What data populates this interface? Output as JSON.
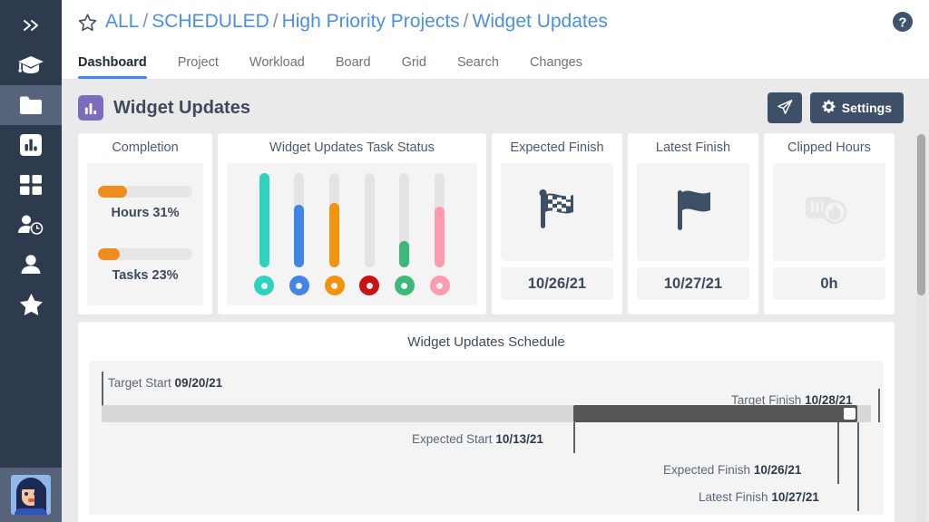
{
  "sidebar": {
    "items": [
      {
        "name": "collapse-expand",
        "icon": "chevron-double-right-icon",
        "active": false
      },
      {
        "name": "learning",
        "icon": "graduation-cap-icon",
        "active": false
      },
      {
        "name": "projects",
        "icon": "folder-icon",
        "active": true
      },
      {
        "name": "reports",
        "icon": "bar-chart-icon",
        "active": false
      },
      {
        "name": "boards",
        "icon": "grid-icon",
        "active": false
      },
      {
        "name": "timesheets",
        "icon": "user-clock-icon",
        "active": false
      },
      {
        "name": "people",
        "icon": "user-icon",
        "active": false
      },
      {
        "name": "favorites",
        "icon": "star-icon",
        "active": false
      }
    ],
    "avatar_label": "user-avatar"
  },
  "header": {
    "favorite_icon": "star-outline-icon",
    "help_icon": "help-circle-icon",
    "breadcrumb": [
      {
        "label": "ALL"
      },
      {
        "label": "SCHEDULED"
      },
      {
        "label": "High Priority Projects"
      },
      {
        "label": "Widget Updates"
      }
    ],
    "separator": "/",
    "tabs": [
      {
        "label": "Dashboard",
        "active": true
      },
      {
        "label": "Project",
        "active": false
      },
      {
        "label": "Workload",
        "active": false
      },
      {
        "label": "Board",
        "active": false
      },
      {
        "label": "Grid",
        "active": false
      },
      {
        "label": "Search",
        "active": false
      },
      {
        "label": "Changes",
        "active": false
      }
    ],
    "active_tab_color": "#3d8bf2",
    "link_color": "#4a90e2"
  },
  "page": {
    "title": "Widget Updates",
    "title_icon": "bar-chart-icon",
    "title_badge_color": "#7c6bbf",
    "send_button": {
      "label": "",
      "icon": "paper-plane-icon"
    },
    "settings_button": {
      "label": "Settings",
      "icon": "gear-icon"
    }
  },
  "cards": {
    "completion": {
      "title": "Completion",
      "bars": [
        {
          "label": "Hours 31%",
          "percent": 31,
          "color": "#f08c1c"
        },
        {
          "label": "Tasks 23%",
          "percent": 23,
          "color": "#f08c1c"
        }
      ]
    },
    "task_status": {
      "title": "Widget Updates Task Status",
      "gauges": [
        {
          "name": "status-1",
          "percent": 100,
          "color": "#2ed3c0"
        },
        {
          "name": "status-2",
          "percent": 66,
          "color": "#4285e8"
        },
        {
          "name": "status-3",
          "percent": 68,
          "color": "#f2930d"
        },
        {
          "name": "status-4",
          "percent": 0,
          "color": "#cc1111"
        },
        {
          "name": "status-5",
          "percent": 28,
          "color": "#3cb878"
        },
        {
          "name": "status-6",
          "percent": 64,
          "color": "#ff9bb0"
        }
      ]
    },
    "expected_finish": {
      "title": "Expected Finish",
      "icon": "checkered-flag-icon",
      "value": "10/26/21"
    },
    "latest_finish": {
      "title": "Latest Finish",
      "icon": "flag-icon",
      "value": "10/27/21"
    },
    "clipped_hours": {
      "title": "Clipped Hours",
      "icon": "clipped-hours-icon",
      "value": "0h"
    }
  },
  "schedule": {
    "title": "Widget Updates Schedule",
    "markers": [
      {
        "name": "target-start",
        "label": "Target Start",
        "value": "09/20/21"
      },
      {
        "name": "target-finish",
        "label": "Target Finish",
        "value": "10/28/21"
      },
      {
        "name": "expected-start",
        "label": "Expected Start",
        "value": "10/13/21"
      },
      {
        "name": "expected-finish",
        "label": "Expected Finish",
        "value": "10/26/21"
      },
      {
        "name": "latest-finish",
        "label": "Latest Finish",
        "value": "10/27/21"
      }
    ]
  },
  "chart_data": {
    "type": "bar",
    "title": "Widget Updates Task Status",
    "categories": [
      "status-1",
      "status-2",
      "status-3",
      "status-4",
      "status-5",
      "status-6"
    ],
    "values": [
      100,
      66,
      68,
      0,
      28,
      64
    ],
    "colors": [
      "#2ed3c0",
      "#4285e8",
      "#f2930d",
      "#cc1111",
      "#3cb878",
      "#ff9bb0"
    ],
    "ylim": [
      0,
      100
    ],
    "ylabel": "",
    "xlabel": "",
    "grid": false,
    "legend": "none"
  }
}
